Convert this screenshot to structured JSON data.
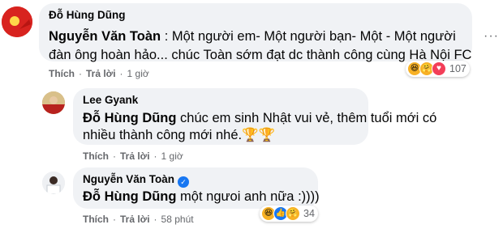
{
  "comments": [
    {
      "author": "Đỗ Hùng Dũng",
      "mention": "Nguyễn Văn Toàn",
      "line1": " : Một người em- Một người bạn- Một - Một người",
      "line2": "đàn ông hoàn hảo... chúc Toàn sớm đạt dc thành công cùng Hà Nội FC",
      "like": "Thích",
      "reply": "Trả lời",
      "time": "1 giờ",
      "reaction_count": "107"
    },
    {
      "author": "Lee Gyank",
      "mention": "Đỗ Hùng Dũng",
      "line1": " chúc em sinh Nhật vui vẻ, thêm tuổi mới có",
      "line2": "nhiều thành công mới nhé.🏆🏆",
      "like": "Thích",
      "reply": "Trả lời",
      "time": "1 giờ"
    },
    {
      "author": "Nguyễn Văn Toàn",
      "mention": "Đỗ Hùng Dũng",
      "line1": " một ngưoi anh nữa :))))",
      "like": "Thích",
      "reply": "Trả lời",
      "time": "58 phút",
      "reaction_count": "34"
    }
  ],
  "more_label": "···",
  "separator": "·",
  "icons": {
    "verified": "verified-badge-icon",
    "reactions": [
      "haha",
      "care",
      "love",
      "like"
    ]
  },
  "colors": {
    "bubble": "#f0f2f5",
    "meta": "#65676b",
    "link_blue": "#1877f2"
  }
}
